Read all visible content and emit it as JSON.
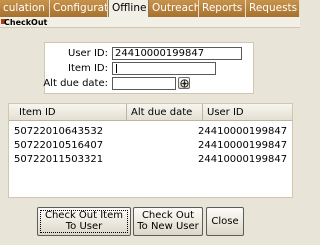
{
  "tabs": [
    {
      "label": "culation",
      "active": false
    },
    {
      "label": "Configuration",
      "active": false
    },
    {
      "label": "Offline",
      "active": true
    },
    {
      "label": "Outreach",
      "active": false
    },
    {
      "label": "Reports",
      "active": false
    },
    {
      "label": "Requests",
      "active": false
    }
  ],
  "page": {
    "title": "CheckOut"
  },
  "form": {
    "user_id_label": "User ID:",
    "user_id_value": "24410000199847",
    "item_id_label": "Item ID:",
    "item_id_value": "",
    "alt_due_date_label": "Alt due date:",
    "alt_due_date_value": ""
  },
  "table": {
    "columns": [
      "Item ID",
      "Alt due date",
      "User ID"
    ],
    "rows": [
      {
        "item_id": "50722010643532",
        "alt_due_date": "",
        "user_id": "24410000199847"
      },
      {
        "item_id": "50722010516407",
        "alt_due_date": "",
        "user_id": "24410000199847"
      },
      {
        "item_id": "50722011503321",
        "alt_due_date": "",
        "user_id": "24410000199847"
      }
    ]
  },
  "buttons": {
    "checkout_item_line1": "Check Out Item",
    "checkout_item_line2": "To User",
    "checkout_new_line1": "Check Out",
    "checkout_new_line2": "To New User",
    "close": "Close"
  },
  "colors": {
    "tab_bg": "#b27a36",
    "tab_active_bg": "#f2efe6",
    "title_icon": "#b03a12",
    "window_bg": "#e8e4d8"
  },
  "icons": {
    "date_picker": "calendar-icon"
  }
}
